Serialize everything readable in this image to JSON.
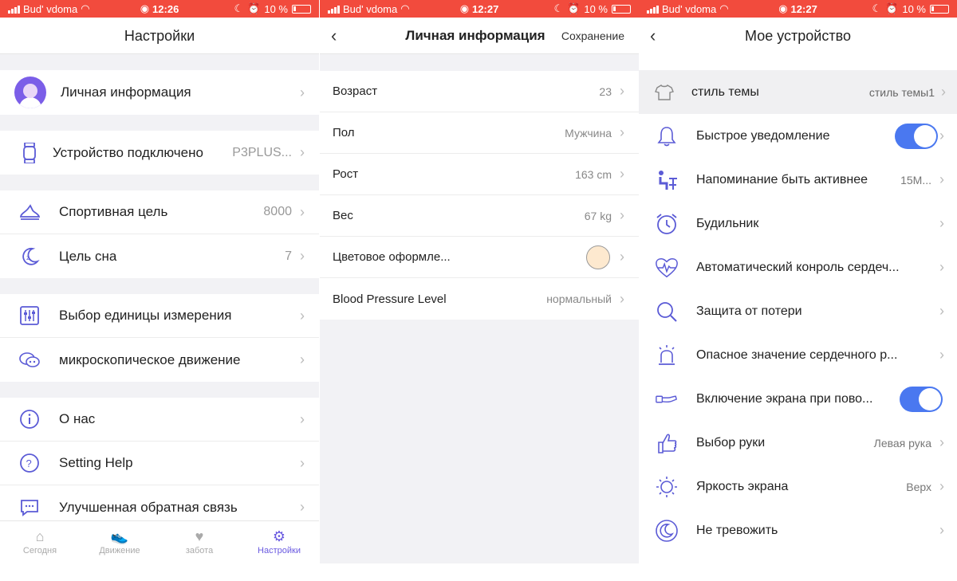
{
  "statusbar": {
    "carrier": "Bud' vdoma",
    "battery": "10 %",
    "times": [
      "12:26",
      "12:27",
      "12:27"
    ]
  },
  "screen1": {
    "title": "Настройки",
    "profile": {
      "label": "Личная информация"
    },
    "device": {
      "label": "Устройство подключено",
      "value": "P3PLUS..."
    },
    "goals": [
      {
        "label": "Спортивная цель",
        "value": "8000",
        "icon": "shoe-icon"
      },
      {
        "label": "Цель сна",
        "value": "7",
        "icon": "moon-icon"
      }
    ],
    "options": [
      {
        "label": "Выбор единицы измерения",
        "icon": "sliders-icon"
      },
      {
        "label": "микроскопическое движение",
        "icon": "chat-icon"
      }
    ],
    "about": [
      {
        "label": "О нас",
        "icon": "info-icon"
      },
      {
        "label": "Setting Help",
        "icon": "help-icon"
      },
      {
        "label": "Улучшенная обратная связь",
        "icon": "feedback-icon"
      }
    ],
    "tabs": [
      {
        "label": "Сегодня",
        "icon": "home-icon"
      },
      {
        "label": "Движение",
        "icon": "shoe-icon"
      },
      {
        "label": "забота",
        "icon": "heart-icon"
      },
      {
        "label": "Настройки",
        "icon": "gear-icon"
      }
    ]
  },
  "screen2": {
    "title": "Личная информация",
    "save_label": "Сохранение",
    "rows": [
      {
        "label": "Возраст",
        "value": "23"
      },
      {
        "label": "Пол",
        "value": "Мужчина"
      },
      {
        "label": "Рост",
        "value": "163 cm"
      },
      {
        "label": "Вес",
        "value": "67 kg"
      },
      {
        "label": "Цветовое оформле...",
        "value": ""
      },
      {
        "label": "Blood Pressure Level",
        "value": "нормальный"
      }
    ],
    "swatch_color": "#fde9cf"
  },
  "screen3": {
    "title": "Мое устройство",
    "theme": {
      "label": "стиль темы",
      "value": "стиль темы1"
    },
    "rows": [
      {
        "label": "Быстрое уведомление",
        "value": "",
        "icon": "bell-icon",
        "toggle": true
      },
      {
        "label": "Напоминание быть активнее",
        "value": "15M...",
        "icon": "sit-icon"
      },
      {
        "label": "Будильник",
        "value": "",
        "icon": "alarm-icon"
      },
      {
        "label": "Автоматический конроль сердеч...",
        "value": "",
        "icon": "heartbeat-icon"
      },
      {
        "label": "Защита от потери",
        "value": "",
        "icon": "search-icon"
      },
      {
        "label": "Опасное значение сердечного р...",
        "value": "",
        "icon": "siren-icon"
      },
      {
        "label": "Включение экрана при пово...",
        "value": "",
        "icon": "wrist-icon",
        "toggle": true
      },
      {
        "label": "Выбор руки",
        "value": "Левая рука",
        "icon": "hand-icon"
      },
      {
        "label": "Яркость экрана",
        "value": "Верх",
        "icon": "sun-icon"
      },
      {
        "label": "Не тревожить",
        "value": "",
        "icon": "dnd-moon-icon"
      }
    ]
  },
  "colors": {
    "statusbar": "#f24b3d",
    "accent": "#6a5ae0",
    "toggle": "#4a78f0"
  }
}
